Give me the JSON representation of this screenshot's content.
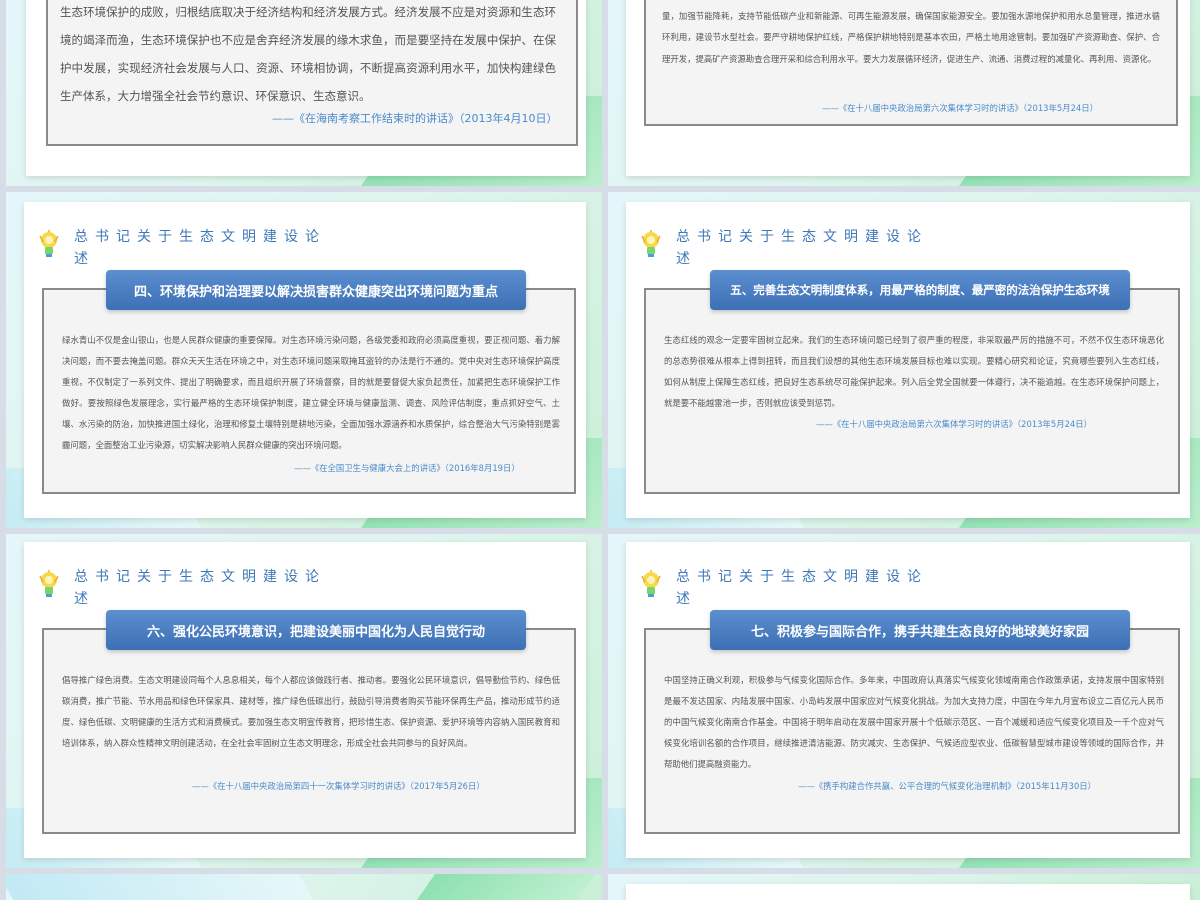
{
  "slide_title": "总书记关于生态文明建设论述",
  "top_left": {
    "text": "生态环境保护的成败，归根结底取决于经济结构和经济发展方式。经济发展不应是对资源和生态环境的竭泽而渔，生态环境保护也不应是舍弃经济发展的缘木求鱼，而是要坚持在发展中保护、在保护中发展，实现经济社会发展与人口、资源、环境相协调，不断提高资源利用水平，加快构建绿色生产体系，大力增强全社会节约意识、环保意识、生态意识。",
    "source": "——《在海南考察工作结束时的讲话》（2013年4月10日）"
  },
  "top_right": {
    "text": "要大力节约集约利用资源，推动资源利用方式根本转变，加强全过程节约管理，大幅降低能源、水、土地消耗强度。要控制能源消费总量，加强节能降耗，支持节能低碳产业和新能源、可再生能源发展，确保国家能源安全。要加强水源地保护和用水总量管理，推进水循环利用，建设节水型社会。要严守耕地保护红线，严格保护耕地特别是基本农田，严格土地用途管制。要加强矿产资源勘查、保护、合理开发，提高矿产资源勘查合理开采和综合利用水平。要大力发展循环经济，促进生产、流通、消费过程的减量化、再利用、资源化。",
    "source": "——《在十八届中央政治局第六次集体学习时的讲话》（2013年5月24日）"
  },
  "slides": [
    {
      "banner": "四、环境保护和治理要以解决损害群众健康突出环境问题为重点",
      "text": "绿水青山不仅是金山银山，也是人民群众健康的重要保障。对生态环境污染问题，各级党委和政府必须高度重视，要正视问题、着力解决问题，而不要去掩盖问题。群众天天生活在环境之中，对生态环境问题采取掩耳盗铃的办法是行不通的。党中央对生态环境保护高度重视，不仅制定了一系列文件、提出了明确要求，而且组织开展了环境督察，目的就是要督促大家负起责任，加紧把生态环境保护工作做好。要按照绿色发展理念，实行最严格的生态环境保护制度，建立健全环境与健康监测、调查、风险评估制度，重点抓好空气、土壤、水污染的防治，加快推进国土绿化，治理和修复土壤特别是耕地污染，全面加强水源涵养和水质保护，综合整治大气污染特别是雾霾问题，全面整治工业污染源，切实解决影响人民群众健康的突出环境问题。",
      "source": "——《在全国卫生与健康大会上的讲话》（2016年8月19日）"
    },
    {
      "banner": "五、完善生态文明制度体系，用最严格的制度、最严密的法治保护生态环境",
      "text": "生态红线的观念一定要牢固树立起来。我们的生态环境问题已经到了很严重的程度，非采取最严厉的措施不可，不然不仅生态环境恶化的总态势很难从根本上得到扭转，而且我们设想的其他生态环境发展目标也难以实现。要精心研究和论证，究竟哪些要列入生态红线，如何从制度上保障生态红线，把良好生态系统尽可能保护起来。列入后全党全国就要一体遵行，决不能逾越。在生态环境保护问题上，就是要不能越雷池一步，否则就应该受到惩罚。",
      "source": "——《在十八届中央政治局第六次集体学习时的讲话》（2013年5月24日）"
    },
    {
      "banner": "六、强化公民环境意识，把建设美丽中国化为人民自觉行动",
      "text": "倡导推广绿色消费。生态文明建设同每个人息息相关，每个人都应该做践行者、推动者。要强化公民环境意识，倡导勤俭节约、绿色低碳消费，推广节能、节水用品和绿色环保家具、建材等，推广绿色低碳出行，鼓励引导消费者购买节能环保再生产品，推动形成节约适度、绿色低碳、文明健康的生活方式和消费模式。要加强生态文明宣传教育，把珍惜生态、保护资源、爱护环境等内容纳入国民教育和培训体系，纳入群众性精神文明创建活动，在全社会牢固树立生态文明理念，形成全社会共同参与的良好风尚。",
      "source": "——《在十八届中央政治局第四十一次集体学习时的讲话》（2017年5月26日）"
    },
    {
      "banner": "七、积极参与国际合作，携手共建生态良好的地球美好家园",
      "text": "中国坚持正确义利观，积极参与气候变化国际合作。多年来，中国政府认真落实气候变化领域南南合作政策承诺，支持发展中国家特别是最不发达国家、内陆发展中国家、小岛屿发展中国家应对气候变化挑战。为加大支持力度，中国在今年九月宣布设立二百亿元人民币的中国气候变化南南合作基金。中国将于明年启动在发展中国家开展十个低碳示范区、一百个减缓和适应气候变化项目及一千个应对气候变化培训名额的合作项目，继续推进清洁能源、防灾减灾、生态保护、气候适应型农业、低碳智慧型城市建设等领域的国际合作，并帮助他们提高融资能力。",
      "source": "——《携手构建合作共赢、公平合理的气候变化治理机制》（2015年11月30日）"
    }
  ]
}
